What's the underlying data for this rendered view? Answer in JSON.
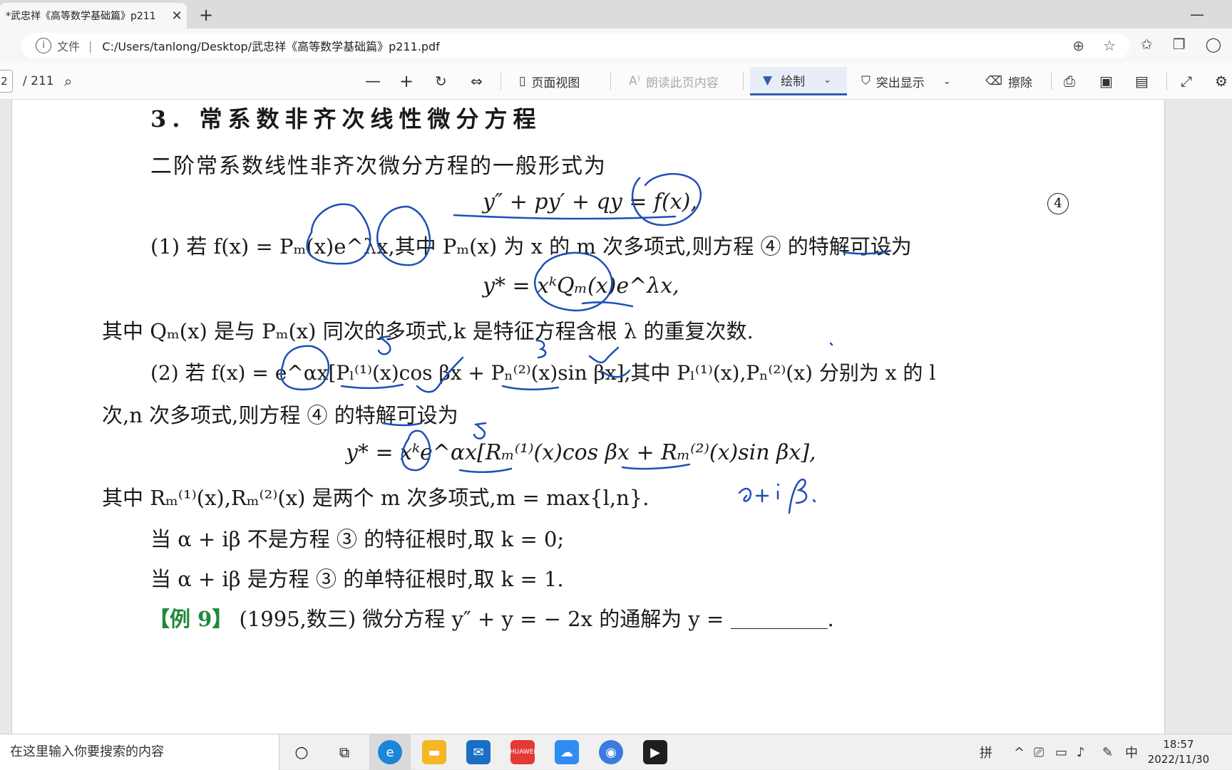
{
  "browser": {
    "tab_title": "*武忠祥《高等数学基础篇》p211",
    "address_label": "文件",
    "url": "C:/Users/tanlong/Desktop/武忠祥《高等数学基础篇》p211.pdf"
  },
  "pdf_toolbar": {
    "page_current": "2",
    "page_total": "/ 211",
    "page_view_label": "页面视图",
    "read_aloud_label": "朗读此页内容",
    "draw_label": "绘制",
    "highlight_label": "突出显示",
    "erase_label": "擦除"
  },
  "document": {
    "heading": "3. 常系数非齐次线性微分方程",
    "intro": "二阶常系数线性非齐次微分方程的一般形式为",
    "eq4": "y″ + py′ + qy = f(x),",
    "eq4_num": "4",
    "case1": "(1) 若 f(x) = Pₘ(x)e^λx,其中 Pₘ(x) 为 x 的 m 次多项式,则方程 ④ 的特解可设为",
    "case1_sol": "y* = xᵏQₘ(x)e^λx,",
    "case1_note": "其中 Qₘ(x) 是与 Pₘ(x) 同次的多项式,k 是特征方程含根 λ 的重复次数.",
    "case2": "(2) 若 f(x) = e^αx[Pₗ⁽¹⁾(x)cos βx + Pₙ⁽²⁾(x)sin βx],其中 Pₗ⁽¹⁾(x),Pₙ⁽²⁾(x) 分别为 x 的 l",
    "case2_cont": "次,n 次多项式,则方程 ④ 的特解可设为",
    "case2_sol": "y* = xᵏe^αx[Rₘ⁽¹⁾(x)cos βx + Rₘ⁽²⁾(x)sin βx],",
    "case2_note": "其中 Rₘ⁽¹⁾(x),Rₘ⁽²⁾(x) 是两个 m 次多项式,m = max{l,n}.",
    "cond1": "当 α + iβ 不是方程 ③ 的特征根时,取 k = 0;",
    "cond2": "当 α + iβ 是方程 ③ 的单特征根时,取 k = 1.",
    "example_tag": "【例 9】",
    "example": "(1995,数三) 微分方程 y″ + y = − 2x 的通解为 y =",
    "example_end": "."
  },
  "taskbar": {
    "search_placeholder": "在这里输入你要搜索的内容",
    "ime1": "拼",
    "ime2": "中",
    "time": "18:57",
    "date": "2022/11/30"
  }
}
